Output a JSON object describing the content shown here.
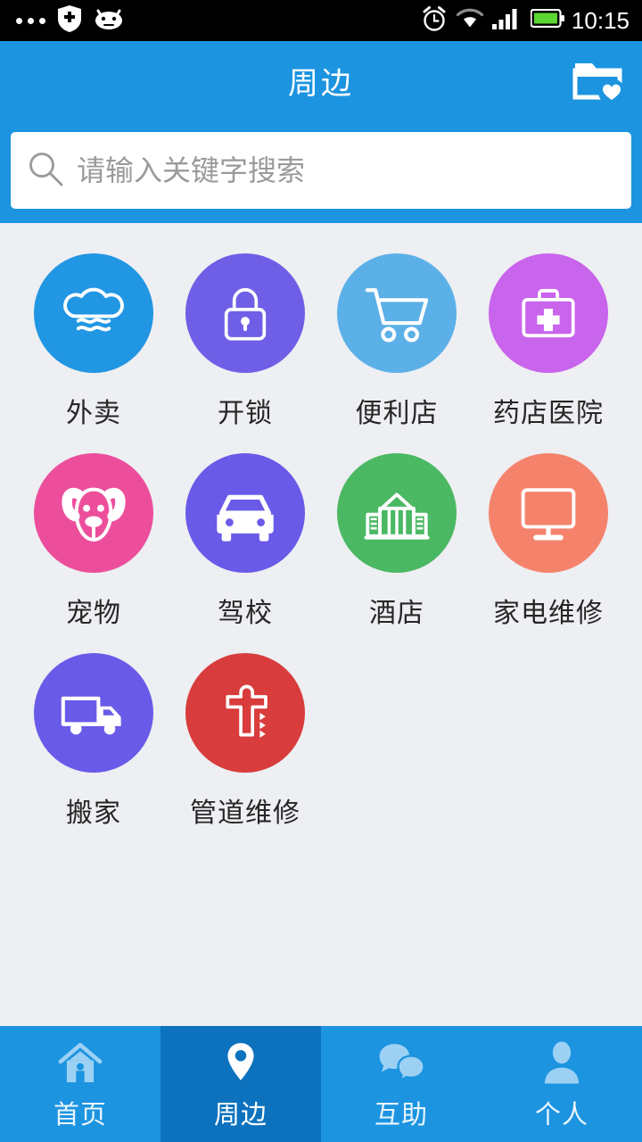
{
  "status_bar": {
    "time": "10:15",
    "left_icons": [
      "more-dots-icon",
      "shield-plus-icon",
      "android-robot-icon"
    ],
    "right_icons": [
      "alarm-clock-icon",
      "wifi-icon",
      "signal-bars-icon",
      "battery-icon"
    ]
  },
  "header": {
    "title": "周边",
    "action_icon": "folder-favorite-icon",
    "background": "#1c94e0"
  },
  "search": {
    "placeholder": "请输入关键字搜索",
    "value": "",
    "icon": "search-icon"
  },
  "grid": {
    "items": [
      {
        "label": "外卖",
        "icon": "chef-hat-icon",
        "color": "#2196e3"
      },
      {
        "label": "开锁",
        "icon": "lock-icon",
        "color": "#6f5fe6"
      },
      {
        "label": "便利店",
        "icon": "shopping-cart-icon",
        "color": "#5cb0e8"
      },
      {
        "label": "药店医院",
        "icon": "medical-kit-icon",
        "color": "#c964ec"
      },
      {
        "label": "宠物",
        "icon": "dog-face-icon",
        "color": "#ec4e9c"
      },
      {
        "label": "驾校",
        "icon": "car-icon",
        "color": "#6a5ae8"
      },
      {
        "label": "酒店",
        "icon": "hotel-building-icon",
        "color": "#4bb863"
      },
      {
        "label": "家电维修",
        "icon": "monitor-icon",
        "color": "#f5836c"
      },
      {
        "label": "搬家",
        "icon": "moving-truck-icon",
        "color": "#6a5ae8"
      },
      {
        "label": "管道维修",
        "icon": "pipe-faucet-icon",
        "color": "#d83c3c"
      }
    ]
  },
  "tabbar": {
    "background": "#1c94e0",
    "active_background": "#0c72bd",
    "tabs": [
      {
        "label": "首页",
        "icon": "home-icon",
        "active": false
      },
      {
        "label": "周边",
        "icon": "location-pin-icon",
        "active": true
      },
      {
        "label": "互助",
        "icon": "chat-bubbles-icon",
        "active": false
      },
      {
        "label": "个人",
        "icon": "person-icon",
        "active": false
      }
    ]
  }
}
